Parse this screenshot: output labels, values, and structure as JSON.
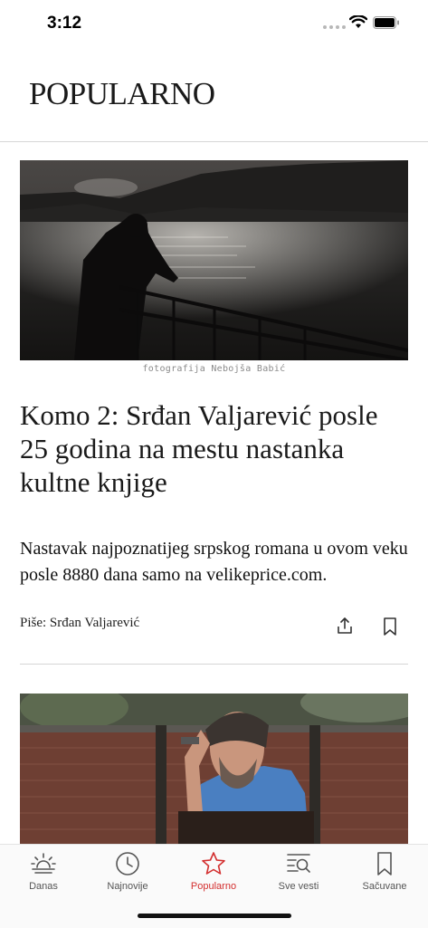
{
  "status_bar": {
    "time": "3:12"
  },
  "header": {
    "title": "POPULARNO"
  },
  "article": {
    "photo_credit": "fotografija Nebojša Babić",
    "headline": "Komo 2: Srđan Valjarević posle 25 godina na mestu nastanka kultne knjige",
    "lede": "Nastavak najpoznatijeg srpskog romana u ovom veku posle 8880 dana  samo na velikeprice.com.",
    "byline": "Piše: Srđan Valjarević"
  },
  "tabs": [
    {
      "label": "Danas",
      "icon": "sunrise-icon",
      "active": false
    },
    {
      "label": "Najnovije",
      "icon": "clock-icon",
      "active": false
    },
    {
      "label": "Popularno",
      "icon": "star-icon",
      "active": true
    },
    {
      "label": "Sve vesti",
      "icon": "list-search-icon",
      "active": false
    },
    {
      "label": "Sačuvane",
      "icon": "bookmark-icon",
      "active": false
    }
  ],
  "colors": {
    "accent": "#d32f2f",
    "tab_inactive": "#555555",
    "divider": "#d6d6d6"
  }
}
